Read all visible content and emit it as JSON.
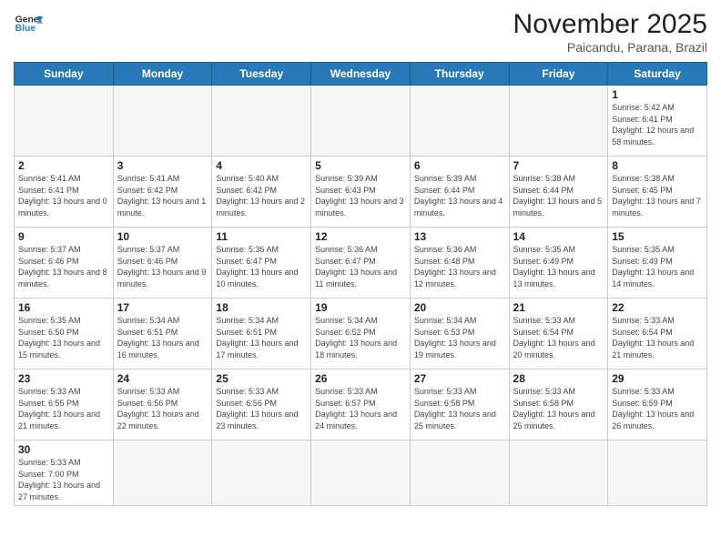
{
  "header": {
    "logo_general": "General",
    "logo_blue": "Blue",
    "month_title": "November 2025",
    "subtitle": "Paicandu, Parana, Brazil"
  },
  "weekdays": [
    "Sunday",
    "Monday",
    "Tuesday",
    "Wednesday",
    "Thursday",
    "Friday",
    "Saturday"
  ],
  "days": {
    "1": {
      "sunrise": "5:42 AM",
      "sunset": "6:41 PM",
      "daylight": "12 hours and 58 minutes."
    },
    "2": {
      "sunrise": "5:41 AM",
      "sunset": "6:41 PM",
      "daylight": "13 hours and 0 minutes."
    },
    "3": {
      "sunrise": "5:41 AM",
      "sunset": "6:42 PM",
      "daylight": "13 hours and 1 minute."
    },
    "4": {
      "sunrise": "5:40 AM",
      "sunset": "6:42 PM",
      "daylight": "13 hours and 2 minutes."
    },
    "5": {
      "sunrise": "5:39 AM",
      "sunset": "6:43 PM",
      "daylight": "13 hours and 3 minutes."
    },
    "6": {
      "sunrise": "5:39 AM",
      "sunset": "6:44 PM",
      "daylight": "13 hours and 4 minutes."
    },
    "7": {
      "sunrise": "5:38 AM",
      "sunset": "6:44 PM",
      "daylight": "13 hours and 5 minutes."
    },
    "8": {
      "sunrise": "5:38 AM",
      "sunset": "6:45 PM",
      "daylight": "13 hours and 7 minutes."
    },
    "9": {
      "sunrise": "5:37 AM",
      "sunset": "6:46 PM",
      "daylight": "13 hours and 8 minutes."
    },
    "10": {
      "sunrise": "5:37 AM",
      "sunset": "6:46 PM",
      "daylight": "13 hours and 9 minutes."
    },
    "11": {
      "sunrise": "5:36 AM",
      "sunset": "6:47 PM",
      "daylight": "13 hours and 10 minutes."
    },
    "12": {
      "sunrise": "5:36 AM",
      "sunset": "6:47 PM",
      "daylight": "13 hours and 11 minutes."
    },
    "13": {
      "sunrise": "5:36 AM",
      "sunset": "6:48 PM",
      "daylight": "13 hours and 12 minutes."
    },
    "14": {
      "sunrise": "5:35 AM",
      "sunset": "6:49 PM",
      "daylight": "13 hours and 13 minutes."
    },
    "15": {
      "sunrise": "5:35 AM",
      "sunset": "6:49 PM",
      "daylight": "13 hours and 14 minutes."
    },
    "16": {
      "sunrise": "5:35 AM",
      "sunset": "6:50 PM",
      "daylight": "13 hours and 15 minutes."
    },
    "17": {
      "sunrise": "5:34 AM",
      "sunset": "6:51 PM",
      "daylight": "13 hours and 16 minutes."
    },
    "18": {
      "sunrise": "5:34 AM",
      "sunset": "6:51 PM",
      "daylight": "13 hours and 17 minutes."
    },
    "19": {
      "sunrise": "5:34 AM",
      "sunset": "6:52 PM",
      "daylight": "13 hours and 18 minutes."
    },
    "20": {
      "sunrise": "5:34 AM",
      "sunset": "6:53 PM",
      "daylight": "13 hours and 19 minutes."
    },
    "21": {
      "sunrise": "5:33 AM",
      "sunset": "6:54 PM",
      "daylight": "13 hours and 20 minutes."
    },
    "22": {
      "sunrise": "5:33 AM",
      "sunset": "6:54 PM",
      "daylight": "13 hours and 21 minutes."
    },
    "23": {
      "sunrise": "5:33 AM",
      "sunset": "6:55 PM",
      "daylight": "13 hours and 21 minutes."
    },
    "24": {
      "sunrise": "5:33 AM",
      "sunset": "6:56 PM",
      "daylight": "13 hours and 22 minutes."
    },
    "25": {
      "sunrise": "5:33 AM",
      "sunset": "6:56 PM",
      "daylight": "13 hours and 23 minutes."
    },
    "26": {
      "sunrise": "5:33 AM",
      "sunset": "6:57 PM",
      "daylight": "13 hours and 24 minutes."
    },
    "27": {
      "sunrise": "5:33 AM",
      "sunset": "6:58 PM",
      "daylight": "13 hours and 25 minutes."
    },
    "28": {
      "sunrise": "5:33 AM",
      "sunset": "6:58 PM",
      "daylight": "13 hours and 25 minutes."
    },
    "29": {
      "sunrise": "5:33 AM",
      "sunset": "6:59 PM",
      "daylight": "13 hours and 26 minutes."
    },
    "30": {
      "sunrise": "5:33 AM",
      "sunset": "7:00 PM",
      "daylight": "13 hours and 27 minutes."
    }
  },
  "labels": {
    "sunrise": "Sunrise:",
    "sunset": "Sunset:",
    "daylight": "Daylight:"
  }
}
